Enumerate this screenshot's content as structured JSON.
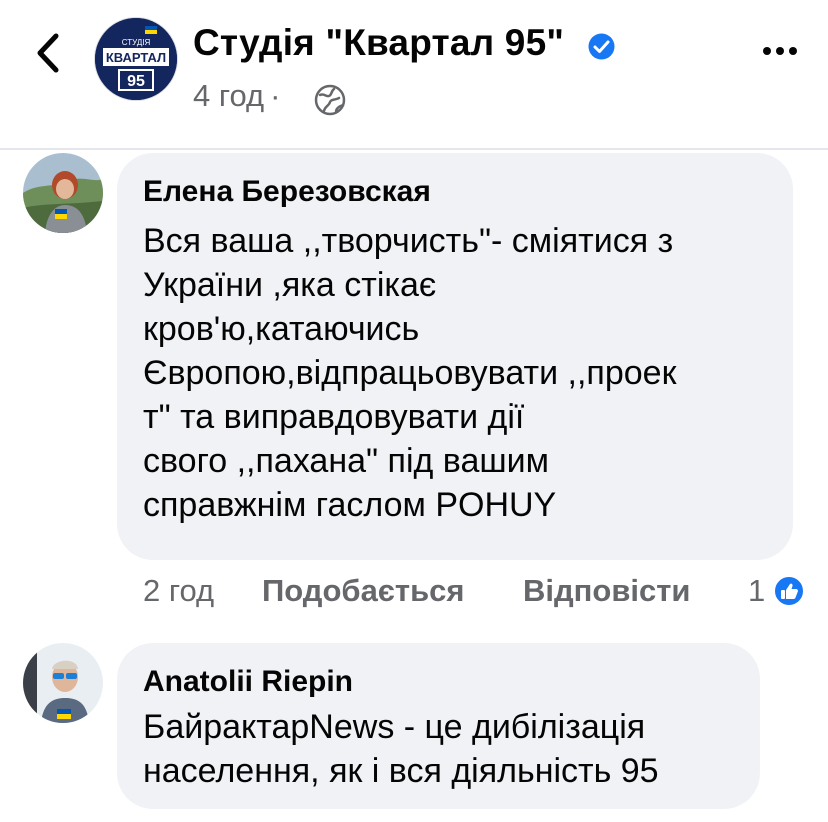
{
  "header": {
    "page_name": "Студія \"Квартал 95\"",
    "time": "4 год",
    "separator": "·",
    "logo_text_top": "СТУДІЯ",
    "logo_text_main": "КВАРТАЛ",
    "logo_text_num": "95"
  },
  "comments": [
    {
      "author": "Елена Березовская",
      "text": "Вся ваша ,,творчисть\"- сміятися з\nУкраїни ,яка стікає\nкров'ю,катаючись\nЄвропою,відпрацьовувати ,,проек\nт\" та виправдовувати дії\nсвого ,,пахана\" під вашим\nсправжнім гаслом POHUY",
      "time": "2 год",
      "like_label": "Подобається",
      "reply_label": "Відповісти",
      "reactions_count": "1"
    },
    {
      "author": "Anatolii Riepin",
      "text": "БайрактарNews - це дибілізація\nнаселення, як і вся діяльність 95"
    }
  ],
  "colors": {
    "verified": "#1877f2",
    "bubble": "#f0f2f5",
    "secondary_text": "#65676b",
    "logo_bg": "#14265e",
    "flag_blue": "#0057b7",
    "flag_yellow": "#ffd700"
  },
  "icons": [
    "back-chevron-icon",
    "verified-badge-icon",
    "globe-icon",
    "more-icon",
    "like-reaction-icon"
  ]
}
